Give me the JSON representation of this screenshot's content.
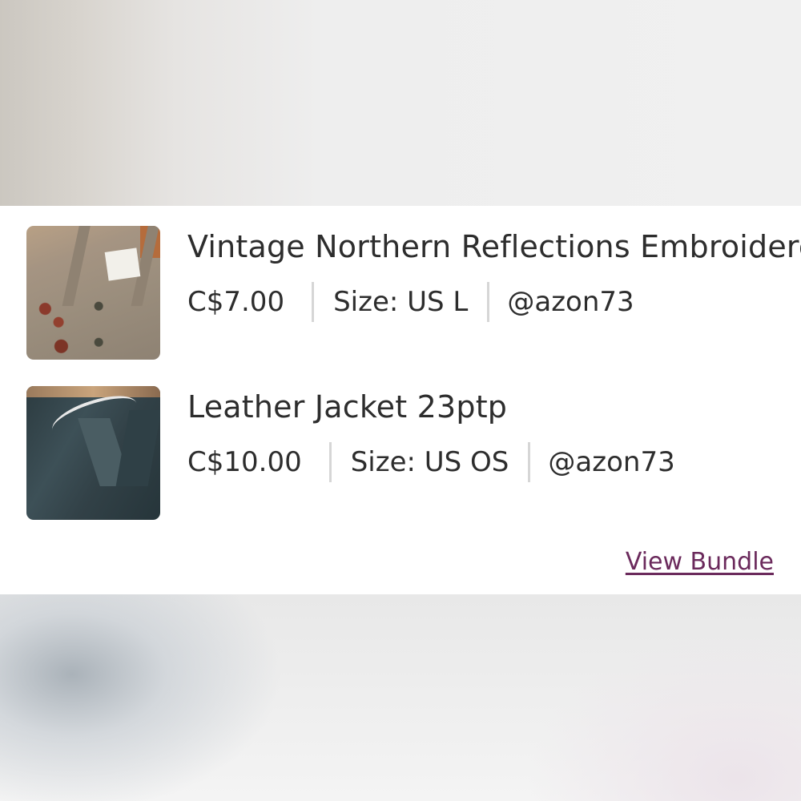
{
  "bundle": {
    "items": [
      {
        "title": "Vintage Northern Reflections Embroidered Sweater",
        "price": "C$7.00",
        "size": "Size: US L",
        "seller": "@azon73",
        "image": "sweater-photo"
      },
      {
        "title": "Leather Jacket 23ptp",
        "price": "C$10.00",
        "size": "Size: US OS",
        "seller": "@azon73",
        "image": "jacket-photo"
      }
    ],
    "view_bundle_label": "View Bundle"
  },
  "colors": {
    "text": "#2d2d2d",
    "link": "#6b2a5c",
    "divider": "#d6d6d6",
    "card": "#ffffff"
  }
}
